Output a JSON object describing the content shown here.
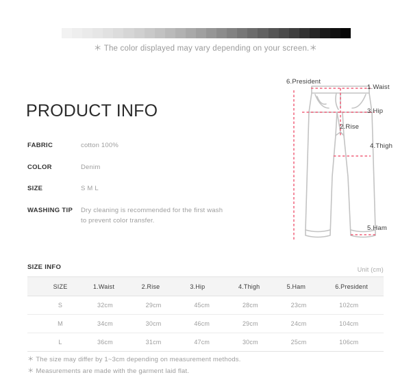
{
  "color_strip": {
    "note": "＊ The color displayed may vary depending on your screen.＊",
    "swatches": [
      "#f2f2f2",
      "#eeeeee",
      "#eaeaea",
      "#e6e6e6",
      "#e1e1e1",
      "#dcdcdc",
      "#d6d6d6",
      "#d0d0d0",
      "#c9c9c9",
      "#c2c2c2",
      "#bababa",
      "#b2b2b2",
      "#a9a9a9",
      "#a0a0a0",
      "#969696",
      "#8c8c8c",
      "#828282",
      "#777777",
      "#6c6c6c",
      "#616161",
      "#555555",
      "#4a4a4a",
      "#3e3e3e",
      "#323232",
      "#262626",
      "#1a1a1a",
      "#101010",
      "#060606"
    ]
  },
  "product_info": {
    "title": "PRODUCT INFO",
    "rows": [
      {
        "key": "FABRIC",
        "value": "cotton 100%"
      },
      {
        "key": "COLOR",
        "value": "Denim"
      },
      {
        "key": "SIZE",
        "value": "S M L"
      },
      {
        "key": "WASHING TIP",
        "value": "Dry cleaning is recommended for the first wash to prevent color transfer."
      }
    ]
  },
  "diagram": {
    "labels": {
      "president": "6.President",
      "waist": "1.Waist",
      "hip": "3.Hip",
      "rise": "2.Rise",
      "thigh": "4.Thigh",
      "ham": "5.Ham"
    },
    "measure_line_color": "#f0607a",
    "garment_outline_color": "#c3c3c3"
  },
  "size_info": {
    "title": "SIZE INFO",
    "unit": "Unit (cm)",
    "columns": [
      "SIZE",
      "1.Waist",
      "2.Rise",
      "3.Hip",
      "4.Thigh",
      "5.Ham",
      "6.President"
    ],
    "rows": [
      {
        "size": "S",
        "waist": "32cm",
        "rise": "29cm",
        "hip": "45cm",
        "thigh": "28cm",
        "ham": "23cm",
        "president": "102cm"
      },
      {
        "size": "M",
        "waist": "34cm",
        "rise": "30cm",
        "hip": "46cm",
        "thigh": "29cm",
        "ham": "24cm",
        "president": "104cm"
      },
      {
        "size": "L",
        "waist": "36cm",
        "rise": "31cm",
        "hip": "47cm",
        "thigh": "30cm",
        "ham": "25cm",
        "president": "106cm"
      }
    ],
    "footnotes": [
      "＊ The size may differ by 1~3cm depending on measurement methods.",
      "＊ Measurements are made with the garment laid flat."
    ]
  }
}
